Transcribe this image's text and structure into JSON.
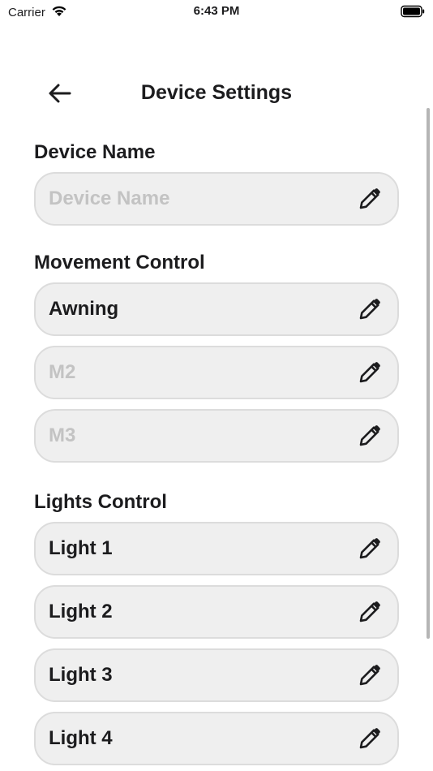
{
  "status": {
    "carrier": "Carrier",
    "time": "6:43 PM"
  },
  "header": {
    "title": "Device Settings"
  },
  "sections": {
    "device_name": {
      "label": "Device Name",
      "fields": [
        {
          "value": "",
          "placeholder": "Device Name"
        }
      ]
    },
    "movement": {
      "label": "Movement Control",
      "fields": [
        {
          "value": "Awning",
          "placeholder": ""
        },
        {
          "value": "",
          "placeholder": "M2"
        },
        {
          "value": "",
          "placeholder": "M3"
        }
      ]
    },
    "lights": {
      "label": "Lights Control",
      "fields": [
        {
          "value": "Light 1",
          "placeholder": ""
        },
        {
          "value": "Light 2",
          "placeholder": ""
        },
        {
          "value": "Light 3",
          "placeholder": ""
        },
        {
          "value": "Light 4",
          "placeholder": ""
        }
      ]
    }
  },
  "icons": {
    "back": "arrow-left-icon",
    "edit": "pencil-icon",
    "wifi": "wifi-icon",
    "battery": "battery-icon"
  }
}
